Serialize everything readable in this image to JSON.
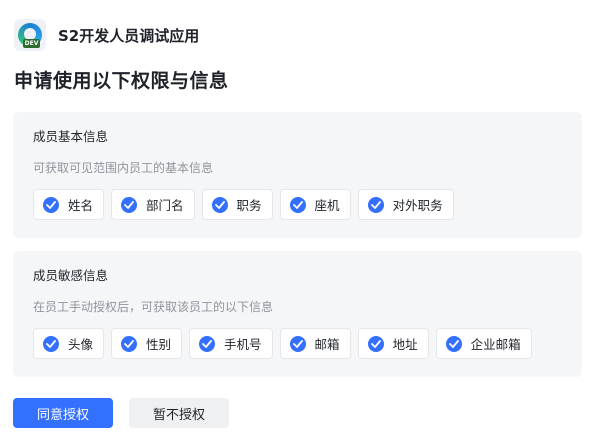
{
  "app": {
    "name": "S2开发人员调试应用",
    "logo_badge": "DEV",
    "logo_icon": "edge-dev-logo"
  },
  "page_title": "申请使用以下权限与信息",
  "sections": [
    {
      "title": "成员基本信息",
      "description": "可获取可见范围内员工的基本信息",
      "items": [
        "姓名",
        "部门名",
        "职务",
        "座机",
        "对外职务"
      ]
    },
    {
      "title": "成员敏感信息",
      "description": "在员工手动授权后，可获取该员工的以下信息",
      "items": [
        "头像",
        "性别",
        "手机号",
        "邮箱",
        "地址",
        "企业邮箱"
      ]
    }
  ],
  "buttons": {
    "approve": "同意授权",
    "deny": "暂不授权"
  },
  "colors": {
    "accent": "#3370ff",
    "card_bg": "#f5f6f7",
    "muted_text": "#8f959e"
  }
}
